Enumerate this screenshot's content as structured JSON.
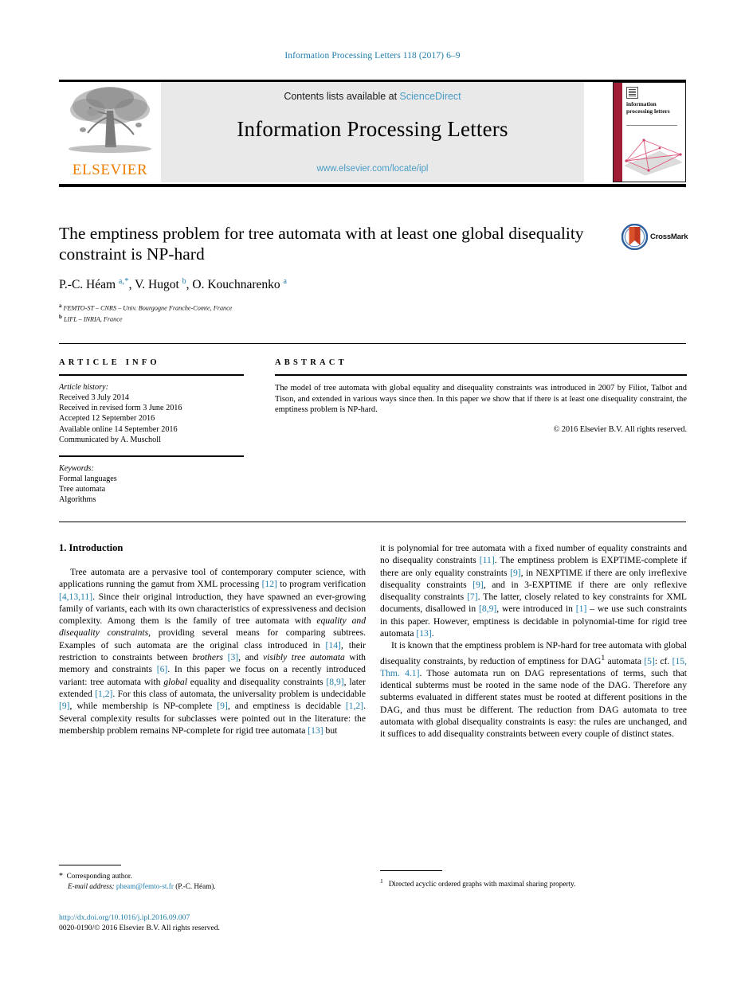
{
  "running_head": "Information Processing Letters 118 (2017) 6–9",
  "masthead": {
    "contents_prefix": "Contents lists available at ",
    "sciencedirect": "ScienceDirect",
    "journal_title": "Information Processing Letters",
    "journal_url": "www.elsevier.com/locate/ipl",
    "publisher_logo_text": "ELSEVIER",
    "cover_title": "information processing letters",
    "colors": {
      "link_blue": "#4a9cc7",
      "running_head_blue": "#1f7dab",
      "elsevier_orange": "#ef7d00",
      "cover_spine_red": "#a01e35",
      "banner_grey": "#e9e9e9"
    }
  },
  "article": {
    "title": "The emptiness problem for tree automata with at least one global disequality constraint is NP-hard",
    "authors_html": "P.-C. Héam <sup class=\"aff\">a</sup><sup class=\"star\">,*</sup>, V. Hugot <sup class=\"aff\">b</sup>, O. Kouchnarenko <sup class=\"aff\">a</sup>",
    "affiliations": [
      {
        "marker": "a",
        "text": "FEMTO-ST – CNRS – Univ. Bourgogne Franche-Comte, France"
      },
      {
        "marker": "b",
        "text": "LIFL – INRIA, France"
      }
    ],
    "crossmark_label": "CrossMark"
  },
  "article_info": {
    "heading": "ARTICLE INFO",
    "history_label": "Article history:",
    "history": [
      "Received 3 July 2014",
      "Received in revised form 3 June 2016",
      "Accepted 12 September 2016",
      "Available online 14 September 2016",
      "Communicated by A. Muscholl"
    ],
    "keywords_label": "Keywords:",
    "keywords": [
      "Formal languages",
      "Tree automata",
      "Algorithms"
    ]
  },
  "abstract": {
    "heading": "ABSTRACT",
    "text": "The model of tree automata with global equality and disequality constraints was introduced in 2007 by Filiot, Talbot and Tison, and extended in various ways since then. In this paper we show that if there is at least one disequality constraint, the emptiness problem is NP-hard.",
    "copyright": "© 2016 Elsevier B.V. All rights reserved."
  },
  "body": {
    "section_number_title": "1. Introduction",
    "left_paragraph_html": "Tree automata are a pervasive tool of contemporary computer science, with applications running the gamut from XML processing <span class=\"cite\">[12]</span> to program verification <span class=\"cite\">[4,13,11]</span>. Since their original introduction, they have spawned an ever-growing family of variants, each with its own characteristics of expressiveness and decision complexity. Among them is the family of tree automata with <span class=\"it\">equality and disequality constraints</span>, providing several means for comparing subtrees. Examples of such automata are the original class introduced in <span class=\"cite\">[14]</span>, their restriction to constraints between <span class=\"it\">brothers</span> <span class=\"cite\">[3]</span>, and <span class=\"it\">visibly tree automata</span> with memory and constraints <span class=\"cite\">[6]</span>. In this paper we focus on a recently introduced variant: tree automata with <span class=\"it\">global</span> equality and disequality constraints <span class=\"cite\">[8,9]</span>, later extended <span class=\"cite\">[1,2]</span>. For this class of automata, the universality problem is undecidable <span class=\"cite\">[9]</span>, while membership is NP-complete <span class=\"cite\">[9]</span>, and emptiness is decidable <span class=\"cite\">[1,2]</span>. Several complexity results for subclasses were pointed out in the literature: the membership problem remains NP-complete for rigid tree automata <span class=\"cite\">[13]</span> but",
    "right_paragraph_1_html": "it is polynomial for tree automata with a fixed number of equality constraints and no disequality constraints <span class=\"cite\">[11]</span>. The emptiness problem is EXPTIME-complete if there are only equality constraints <span class=\"cite\">[9]</span>, in NEXPTIME if there are only irreflexive disequality constraints <span class=\"cite\">[9]</span>, and in 3-EXPTIME if there are only reflexive disequality constraints <span class=\"cite\">[7]</span>. The latter, closely related to key constraints for XML documents, disallowed in <span class=\"cite\">[8,9]</span>, were introduced in <span class=\"cite\">[1]</span> – we use such constraints in this paper. However, emptiness is decidable in polynomial-time for rigid tree automata <span class=\"cite\">[13]</span>.",
    "right_paragraph_2_html": "It is known that the emptiness problem is NP-hard for tree automata with global disequality constraints, by reduction of emptiness for DAG<sup>1</sup> automata <span class=\"cite\">[5]</span>: cf. <span class=\"cite\">[15, Thm. 4.1]</span>. Those automata run on DAG representations of terms, such that identical subterms must be rooted in the same node of the DAG. Therefore any subterms evaluated in different states must be rooted at different positions in the DAG, and thus must be different. The reduction from DAG automata to tree automata with global disequality constraints is easy: the rules are unchanged, and it suffices to add disequality constraints between every couple of distinct states."
  },
  "footnotes": {
    "corresponding_author": "Corresponding author.",
    "email_label": "E-mail address:",
    "email": "pheam@femto-st.fr",
    "email_suffix": "(P.-C. Héam).",
    "footnote_1_marker": "1",
    "footnote_1_text": "Directed acyclic ordered graphs with maximal sharing property."
  },
  "imprint": {
    "doi": "http://dx.doi.org/10.1016/j.ipl.2016.09.007",
    "issn_copyright": "0020-0190/© 2016 Elsevier B.V. All rights reserved."
  }
}
